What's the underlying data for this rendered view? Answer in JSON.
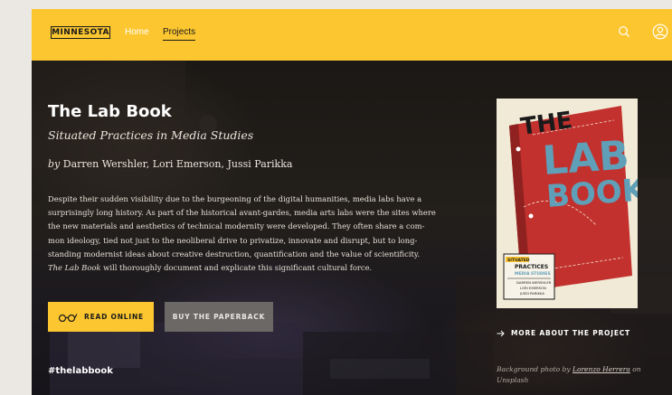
{
  "header": {
    "logo": "MINNESOTA",
    "nav": [
      {
        "label": "Home"
      },
      {
        "label": "Projects"
      }
    ]
  },
  "book": {
    "title": "The Lab Book",
    "subtitle": "Situated Practices in Media Studies",
    "by": "by",
    "authors": "Darren Wershler, Lori Emerson, Jussi Parikka",
    "description": [
      "Despite their sudden visibility due to the burgeoning of the digital humanities, media labs have a",
      "surprisingly long history. As part of the historical avant-gardes, media arts labs were the sites where",
      "the new materials and aesthetics of technical modernity were developed. They often share a com-",
      "mon ideology, tied not just to the neoliberal drive to privatize, innovate and disrupt, but to long-",
      "standing modernist ideas about creative destruction, quantification and the value of scientificity."
    ],
    "description_last_em": "The Lab Book",
    "description_last_rest": " will thoroughly document and explicate this significant cultural force."
  },
  "buttons": {
    "read_online": "READ ONLINE",
    "buy_paperback": "BUY THE PAPERBACK",
    "more_about": "MORE ABOUT THE PROJECT"
  },
  "hashtag": "#thelabbook",
  "credit": {
    "prefix": "Background photo by",
    "author": "Lorenzo Herrera",
    "suffix": "on Unsplash"
  },
  "cover": {
    "word1": "THE",
    "word2": "LAB",
    "word3": "BOOK",
    "series_tag": "SITUATED",
    "series_line1": "PRACTICES",
    "series_line2": "MEDIA STUDIES",
    "authors": [
      "DARREN WERSHLER",
      "LORI EMERSON",
      "JUSSI PARIKKA"
    ]
  },
  "colors": {
    "accent": "#fcc630",
    "hero_bg": "#1b1815",
    "cover_red": "#c2312e",
    "cover_blue": "#5f9fb8"
  },
  "icons": [
    "search-icon",
    "user-icon",
    "glasses-icon",
    "arrow-right-icon"
  ]
}
